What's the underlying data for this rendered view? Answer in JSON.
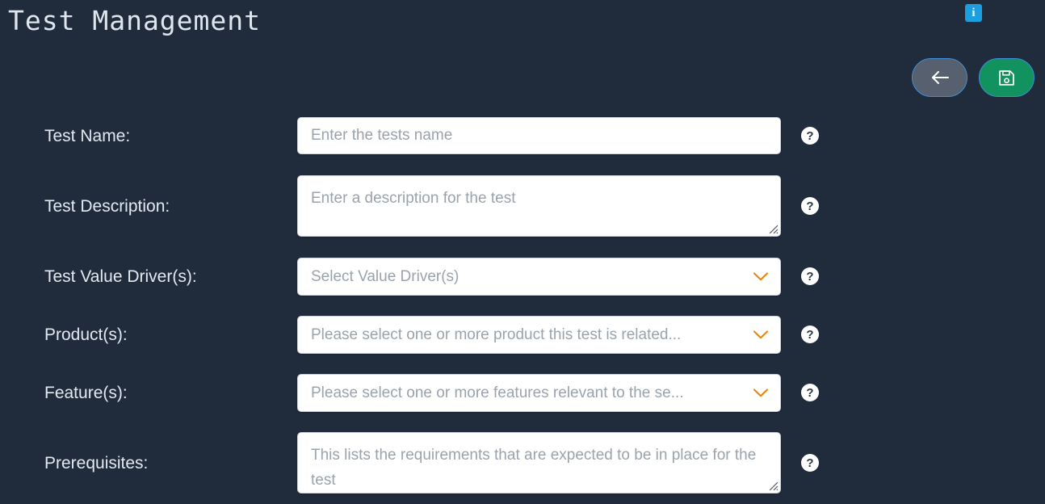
{
  "page": {
    "title": "Test Management",
    "background_color": "#202b3c"
  },
  "header": {
    "info_badge": {
      "icon": "info-icon",
      "glyph": "i",
      "color": "#1a9fe0"
    },
    "actions": [
      {
        "name": "back-button",
        "icon": "arrow-left-icon",
        "color": "#57606e",
        "border_color": "#3f8fd8"
      },
      {
        "name": "save-button",
        "icon": "floppy-disk-save-icon",
        "color": "#11925e",
        "border_color": "#3f8fd8"
      }
    ]
  },
  "form": {
    "help_icon_glyph": "?",
    "fields": [
      {
        "label": "Test Name:",
        "control": "text-input",
        "placeholder": "Enter the tests name",
        "value": "",
        "help": "?"
      },
      {
        "label": "Test Description:",
        "control": "textarea",
        "placeholder": "Enter a description for the test",
        "value": "",
        "help": "?"
      },
      {
        "label": "Test Value Driver(s):",
        "control": "select",
        "placeholder": "Select Value Driver(s)",
        "value": "",
        "help": "?"
      },
      {
        "label": "Product(s):",
        "control": "select",
        "placeholder": "Please select one or more product this test is related...",
        "value": "",
        "help": "?"
      },
      {
        "label": "Feature(s):",
        "control": "select",
        "placeholder": "Please select one or more features relevant to the se...",
        "value": "",
        "help": "?"
      },
      {
        "label": "Prerequisites:",
        "control": "textarea",
        "placeholder": "This lists the requirements that are expected to be in place for the test",
        "value": "",
        "help": "?"
      }
    ]
  },
  "colors": {
    "chevron": "#e8850c",
    "accent_blue": "#1a9fe0",
    "save_green": "#11925e",
    "back_gray": "#57606e",
    "field_white": "#ffffff",
    "placeholder_gray": "#9aa3ac"
  }
}
